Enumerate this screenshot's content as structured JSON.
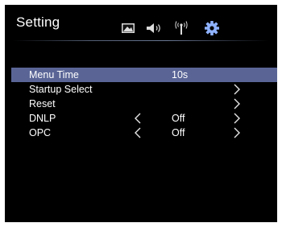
{
  "header": {
    "title": "Setting",
    "tabs": [
      {
        "name": "picture",
        "icon": "picture-icon",
        "active": false
      },
      {
        "name": "sound",
        "icon": "speaker-icon",
        "active": false
      },
      {
        "name": "channel",
        "icon": "antenna-icon",
        "active": false
      },
      {
        "name": "setting",
        "icon": "gear-icon",
        "active": true
      }
    ]
  },
  "colors": {
    "selected_row": "#5a6596",
    "accent": "#8fb2ff"
  },
  "menu": {
    "items": [
      {
        "label": "Menu Time",
        "value": "10s",
        "selected": true,
        "left_arrow": false,
        "right_arrow": false
      },
      {
        "label": "Startup Select",
        "value": "",
        "selected": false,
        "left_arrow": false,
        "right_arrow": true
      },
      {
        "label": "Reset",
        "value": "",
        "selected": false,
        "left_arrow": false,
        "right_arrow": true
      },
      {
        "label": "DNLP",
        "value": "Off",
        "selected": false,
        "left_arrow": true,
        "right_arrow": true
      },
      {
        "label": "OPC",
        "value": "Off",
        "selected": false,
        "left_arrow": true,
        "right_arrow": true
      }
    ]
  }
}
